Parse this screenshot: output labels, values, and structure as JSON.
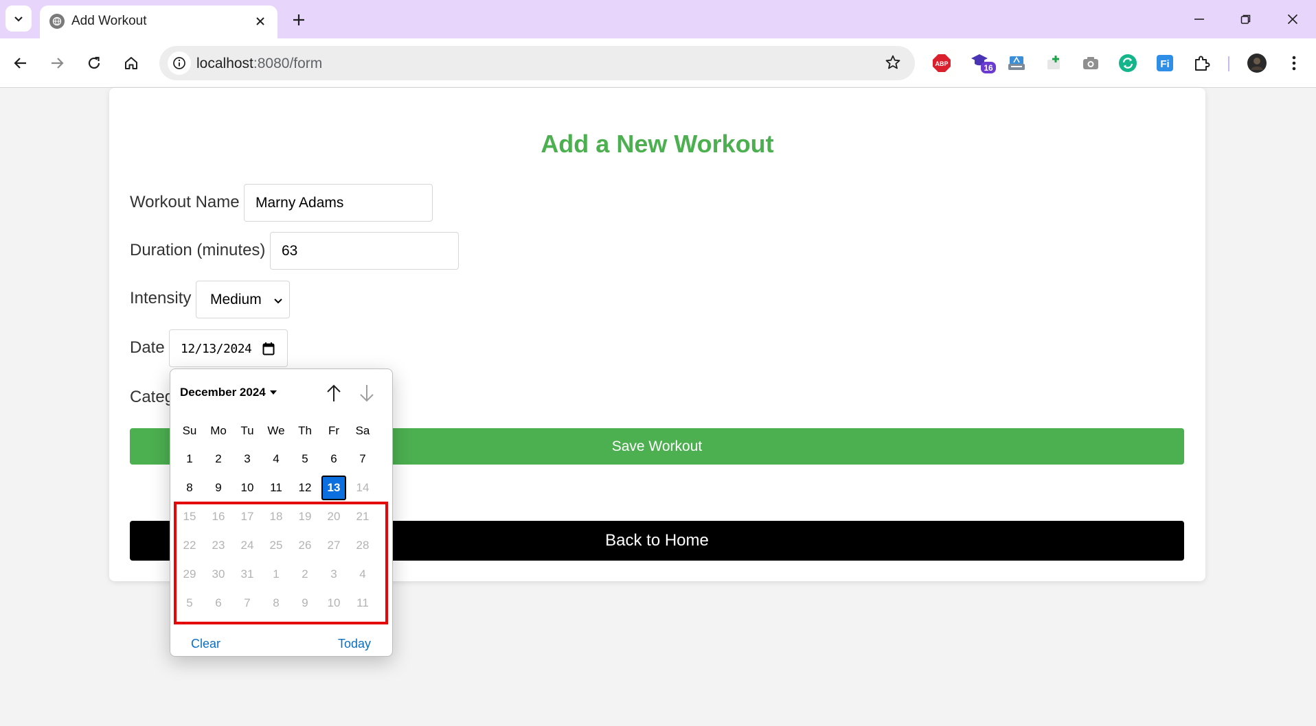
{
  "browser": {
    "tab_title": "Add Workout",
    "url_host": "localhost",
    "url_path": ":8080/form",
    "extensions": [
      "adblock-plus-icon",
      "graduation-cap-icon",
      "translate-icon",
      "add-screenshot-icon",
      "camera-icon",
      "sync-icon",
      "fi-icon",
      "puzzle-icon"
    ],
    "abp_label": "ABP",
    "badge_count": "16",
    "fi_label": "Fi"
  },
  "page": {
    "title": "Add a New Workout",
    "labels": {
      "workout_name": "Workout Name",
      "duration": "Duration (minutes)",
      "intensity": "Intensity",
      "date": "Date",
      "category": "Categ"
    },
    "values": {
      "workout_name": "Marny Adams",
      "duration": "63",
      "intensity": "Medium",
      "date": "12/13/2024"
    },
    "save_button": "Save Workout",
    "home_button": "Back to Home"
  },
  "date_picker": {
    "month_label": "December 2024",
    "weekdays": [
      "Su",
      "Mo",
      "Tu",
      "We",
      "Th",
      "Fr",
      "Sa"
    ],
    "weeks": [
      [
        "1",
        "2",
        "3",
        "4",
        "5",
        "6",
        "7"
      ],
      [
        "8",
        "9",
        "10",
        "11",
        "12",
        "13",
        "14"
      ],
      [
        "15",
        "16",
        "17",
        "18",
        "19",
        "20",
        "21"
      ],
      [
        "22",
        "23",
        "24",
        "25",
        "26",
        "27",
        "28"
      ],
      [
        "29",
        "30",
        "31",
        "1",
        "2",
        "3",
        "4"
      ],
      [
        "5",
        "6",
        "7",
        "8",
        "9",
        "10",
        "11"
      ]
    ],
    "selected_day": "13",
    "clear_label": "Clear",
    "today_label": "Today"
  }
}
